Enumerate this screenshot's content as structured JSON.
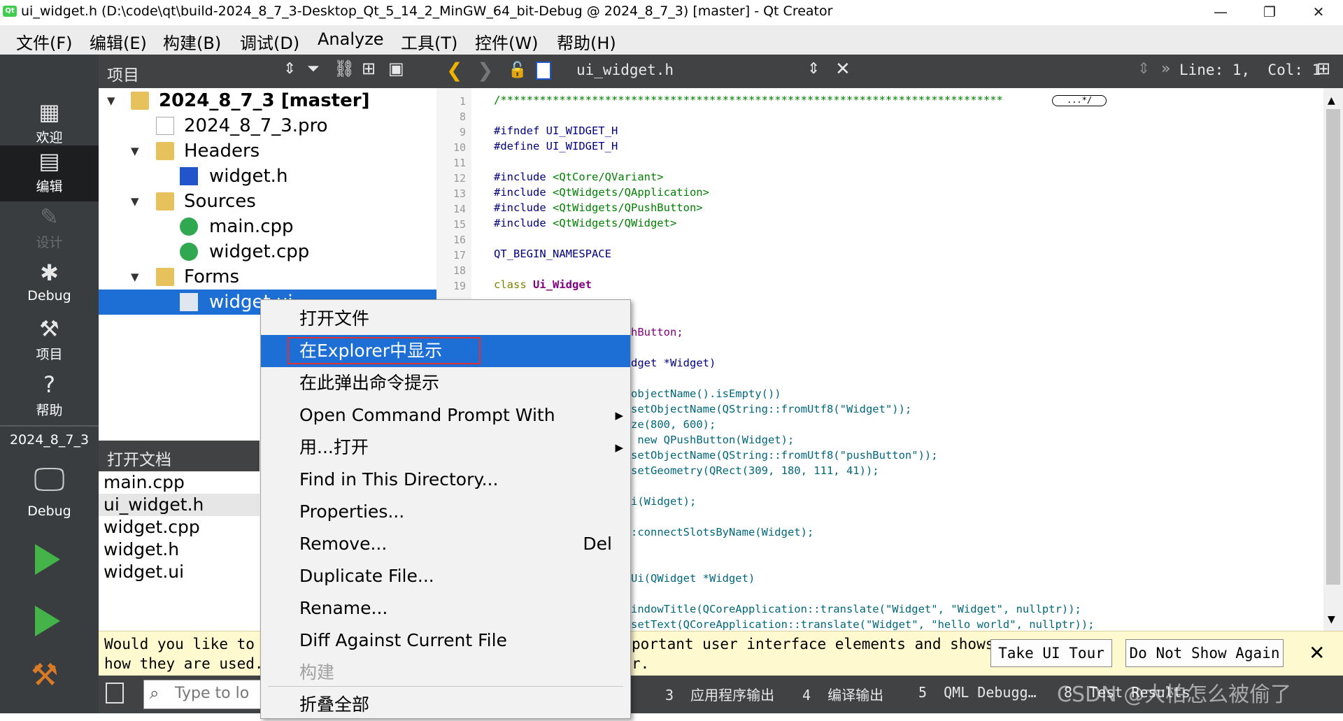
{
  "window": {
    "title": "ui_widget.h (D:\\code\\qt\\build-2024_8_7_3-Desktop_Qt_5_14_2_MinGW_64_bit-Debug @ 2024_8_7_3) [master] - Qt Creator",
    "logo_text": "Qt",
    "minimize": "—",
    "maximize": "❐",
    "close": "✕"
  },
  "menubar": [
    "文件(F)",
    "编辑(E)",
    "构建(B)",
    "调试(D)",
    "Analyze",
    "工具(T)",
    "控件(W)",
    "帮助(H)"
  ],
  "modes": [
    {
      "label": "欢迎",
      "icon": "grid-icon"
    },
    {
      "label": "编辑",
      "icon": "document-icon"
    },
    {
      "label": "设计",
      "icon": "pencil-icon"
    },
    {
      "label": "Debug",
      "icon": "bug-icon"
    },
    {
      "label": "项目",
      "icon": "wrench-icon"
    },
    {
      "label": "帮助",
      "icon": "help-icon"
    }
  ],
  "kit": {
    "project": "2024_8_7_3",
    "label": "Debug"
  },
  "project_panel": {
    "title": "项目"
  },
  "tree": {
    "root": "2024_8_7_3 [master]",
    "pro": "2024_8_7_3.pro",
    "headers": "Headers",
    "widget_h": "widget.h",
    "sources": "Sources",
    "main_cpp": "main.cpp",
    "widget_cpp": "widget.cpp",
    "forms": "Forms",
    "widget_ui": "widget.ui"
  },
  "open_docs": {
    "title": "打开文档",
    "items": [
      "main.cpp",
      "ui_widget.h",
      "widget.cpp",
      "widget.h",
      "widget.ui"
    ]
  },
  "editor": {
    "filename": "ui_widget.h",
    "position": "Line: 1,  Col: 1",
    "fold_marker": "...*/"
  },
  "code": {
    "l1": "/*****************************************************************************",
    "line_numbers": [
      "1",
      "8",
      "9",
      "10",
      "11",
      "12",
      "13",
      "14",
      "15",
      "16",
      "17",
      "18",
      "19"
    ],
    "ifndef": "#ifndef UI_WIDGET_H",
    "define": "#define UI_WIDGET_H",
    "inc1a": "#include ",
    "inc1b": "<QtCore/QVariant>",
    "inc2a": "#include ",
    "inc2b": "<QtWidgets/QApplication>",
    "inc3a": "#include ",
    "inc3b": "<QtWidgets/QPushButton>",
    "inc4a": "#include ",
    "inc4b": "<QtWidgets/QWidget>",
    "ns": "QT_BEGIN_NAMESPACE",
    "cls_kw": "class ",
    "cls_name": "Ui_Widget",
    "r1": "hButton;",
    "r2": "dget *Widget)",
    "r3": "objectName().isEmpty())",
    "r4": "setObjectName(QString::fromUtf8(\"Widget\"));",
    "r5": "ze(800, 600);",
    "r6": " new QPushButton(Widget);",
    "r7": "setObjectName(QString::fromUtf8(\"pushButton\"));",
    "r8": "setGeometry(QRect(309, 180, 111, 41));",
    "r9": "i(Widget);",
    "r10": ":connectSlotsByName(Widget);",
    "r11": "Ui(QWidget *Widget)",
    "r12": "indowTitle(QCoreApplication::translate(\"Widget\", \"Widget\", nullptr));",
    "r13": "setText(QCoreApplication::translate(\"Widget\", \"hello world\", nullptr));"
  },
  "infobar": {
    "line1_left": "Would you like to t",
    "line2_left": "how they are used.",
    "line1_right": "portant user interface elements and shows",
    "line2_right": "r.",
    "take_tour": "Take UI Tour",
    "dont_show": "Do Not Show Again",
    "close": "✕"
  },
  "statusbar": {
    "locator_placeholder": "Type to lo",
    "tabs": [
      "3  应用程序输出",
      "4  编译输出",
      "5  QML Debugg…",
      "8  Test Results"
    ],
    "watermark": "CSDN @大柏怎么被偷了"
  },
  "context_menu": [
    {
      "label": "打开文件"
    },
    {
      "label": "在Explorer中显示",
      "selected": true
    },
    {
      "label": "在此弹出命令提示"
    },
    {
      "label": "Open Command Prompt With",
      "submenu": true
    },
    {
      "label": "用...打开",
      "submenu": true
    },
    {
      "label": "Find in This Directory..."
    },
    {
      "label": "Properties..."
    },
    {
      "label": "Remove...",
      "shortcut": "Del"
    },
    {
      "label": "Duplicate File..."
    },
    {
      "label": "Rename..."
    },
    {
      "label": "Diff Against Current File"
    },
    {
      "label": "构建",
      "disabled": true
    },
    {
      "label": "折叠全部"
    }
  ],
  "colors": {
    "selection": "#1d6fd6",
    "highlight_box": "#e03030",
    "panel_dark": "#404244",
    "modebar": "#3a3d40"
  }
}
